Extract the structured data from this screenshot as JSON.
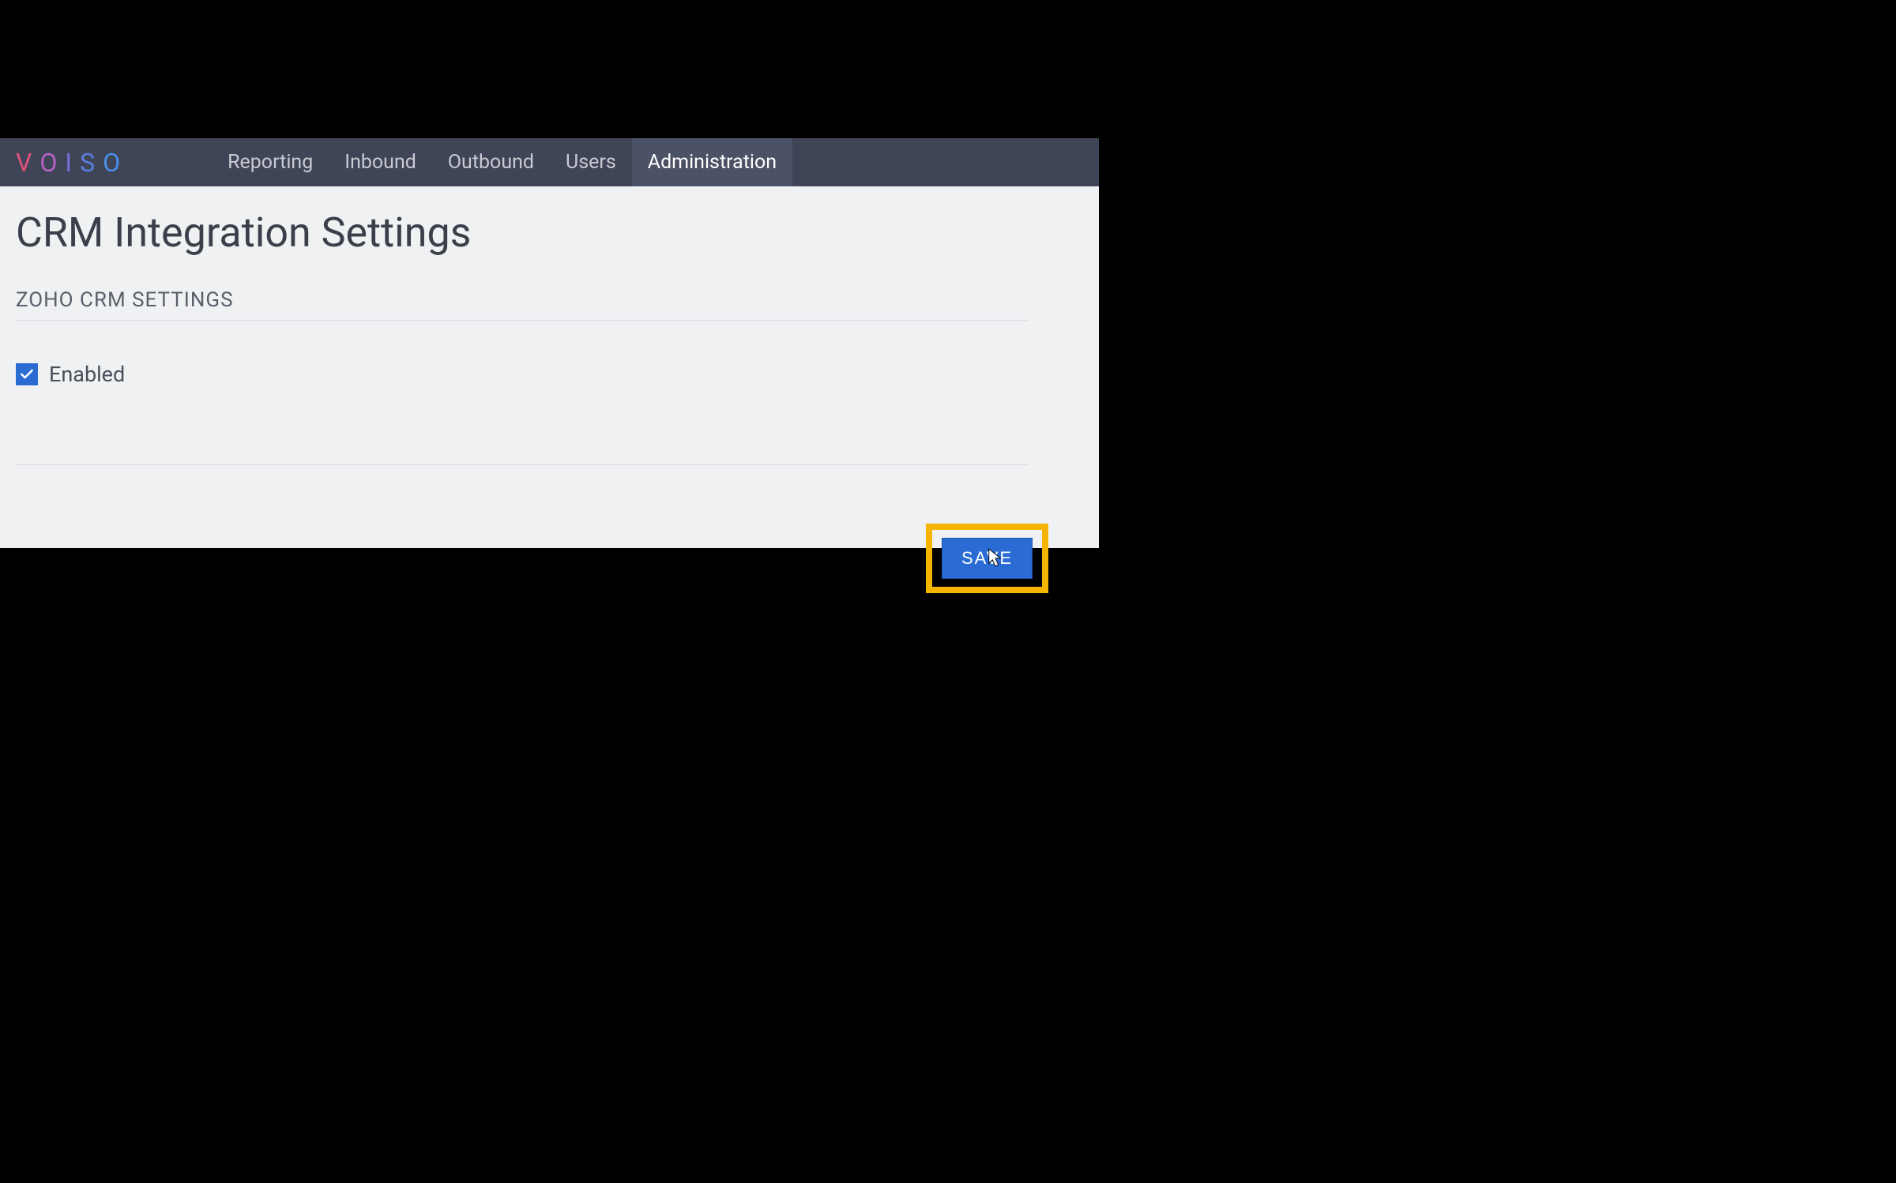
{
  "logo": {
    "v": "V",
    "o1": "O",
    "i": "I",
    "s": "S",
    "o2": "O"
  },
  "nav": {
    "items": [
      {
        "label": "Reporting",
        "active": false
      },
      {
        "label": "Inbound",
        "active": false
      },
      {
        "label": "Outbound",
        "active": false
      },
      {
        "label": "Users",
        "active": false
      },
      {
        "label": "Administration",
        "active": true
      }
    ]
  },
  "page": {
    "title": "CRM Integration Settings",
    "section_title": "ZOHO CRM SETTINGS",
    "enabled_label": "Enabled",
    "enabled_checked": true,
    "save_label": "SAVE"
  }
}
